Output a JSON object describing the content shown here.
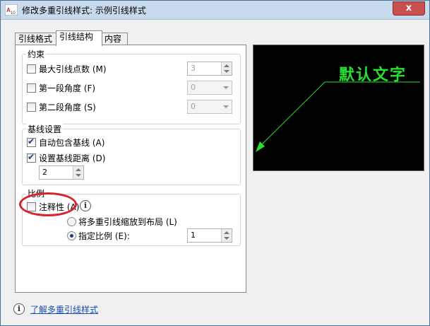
{
  "window": {
    "title": "修改多重引线样式: 示例引线样式",
    "close_glyph": "x",
    "icon": "autocad-app-icon"
  },
  "tabs": [
    {
      "label": "引线格式",
      "active": false
    },
    {
      "label": "引线结构",
      "active": true
    },
    {
      "label": "内容",
      "active": false
    }
  ],
  "constraints": {
    "group_label": "约束",
    "max_points": {
      "label": "最大引线点数 (M)",
      "checked": false,
      "value": "3"
    },
    "first_angle": {
      "label": "第一段角度 (F)",
      "checked": false,
      "value": "0"
    },
    "second_angle": {
      "label": "第二段角度 (S)",
      "checked": false,
      "value": "0"
    }
  },
  "landing": {
    "group_label": "基线设置",
    "auto_include": {
      "label": "自动包含基线 (A)",
      "checked": true
    },
    "set_distance": {
      "label": "设置基线距离 (D)",
      "checked": true,
      "value": "2"
    }
  },
  "scale": {
    "group_label": "比例",
    "annotative": {
      "label": "注释性 (A)",
      "checked": false
    },
    "scale_to_layout": {
      "label": "将多重引线缩放到布局 (L)",
      "selected": false
    },
    "specify_scale": {
      "label": "指定比例 (E):",
      "selected": true,
      "value": "1"
    }
  },
  "preview": {
    "text": "默认文字",
    "color": "#25e02c"
  },
  "footer": {
    "link": "了解多重引线样式"
  },
  "annotation": {
    "color": "#d8232a"
  }
}
